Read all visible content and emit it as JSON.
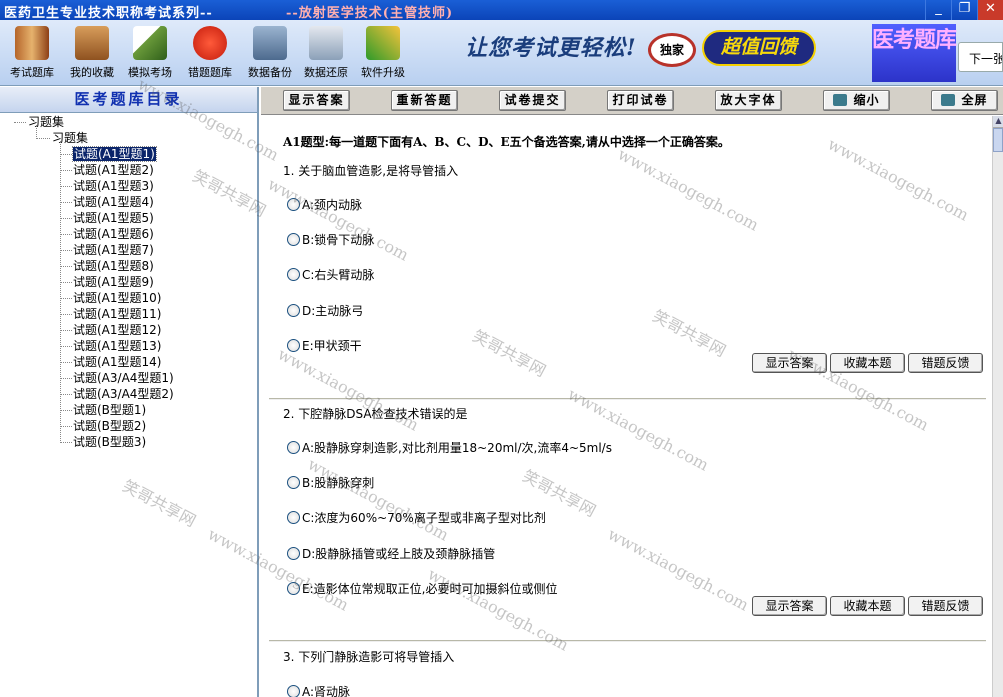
{
  "window": {
    "title_main": "医药卫生专业技术职称考试系列--",
    "title_sub": "--放射医学技术(主管技师)",
    "min": "_",
    "restore": "❐",
    "close": "✕"
  },
  "toolbar": {
    "items": [
      {
        "label": "考试题库",
        "icon": "book-icon"
      },
      {
        "label": "我的收藏",
        "icon": "box-icon"
      },
      {
        "label": "模拟考场",
        "icon": "pencil-paper-icon"
      },
      {
        "label": "错题题库",
        "icon": "red-x-icon"
      },
      {
        "label": "数据备份",
        "icon": "backup-chart-icon"
      },
      {
        "label": "数据还原",
        "icon": "restore-clock-icon"
      },
      {
        "label": "软件升级",
        "icon": "upgrade-arrow-icon"
      }
    ],
    "ad_slogan": "让您考试更轻松!",
    "ad_exclusive": "独家",
    "ad_badge": "超值回馈",
    "logo_text": "医考题库",
    "next_page": "下一张"
  },
  "left_panel": {
    "header": "医考题库目录",
    "root": "习题集",
    "child": "习题集",
    "items": [
      "试题(A1型题1)",
      "试题(A1型题2)",
      "试题(A1型题3)",
      "试题(A1型题4)",
      "试题(A1型题5)",
      "试题(A1型题6)",
      "试题(A1型题7)",
      "试题(A1型题8)",
      "试题(A1型题9)",
      "试题(A1型题10)",
      "试题(A1型题11)",
      "试题(A1型题12)",
      "试题(A1型题13)",
      "试题(A1型题14)",
      "试题(A3/A4型题1)",
      "试题(A3/A4型题2)",
      "试题(B型题1)",
      "试题(B型题2)",
      "试题(B型题3)"
    ],
    "selected_index": 0
  },
  "action_bar": {
    "show_answer": "显示答案",
    "redo": "重新答题",
    "submit": "试卷提交",
    "print": "打印试卷",
    "enlarge_font": "放大字体",
    "shrink": "缩小",
    "fullscreen": "全屏"
  },
  "instructions": "A1题型:每一道题下面有A、B、C、D、E五个备选答案,请从中选择一个正确答案。",
  "question_buttons": {
    "show_answer": "显示答案",
    "favorite": "收藏本题",
    "feedback": "错题反馈"
  },
  "questions": [
    {
      "text": "1. 关于脑血管造影,是将导管插入",
      "options": [
        "A:颈内动脉",
        "B:锁骨下动脉",
        "C:右头臂动脉",
        "D:主动脉弓",
        "E:甲状颈干"
      ]
    },
    {
      "text": "2. 下腔静脉DSA检查技术错误的是",
      "options": [
        "A:股静脉穿刺造影,对比剂用量18~20ml/次,流率4~5ml/s",
        "B:股静脉穿刺",
        "C:浓度为60%~70%离子型或非离子型对比剂",
        "D:股静脉插管或经上肢及颈静脉插管",
        "E:造影体位常规取正位,必要时可加摄斜位或侧位"
      ]
    },
    {
      "text": "3. 下列门静脉造影可将导管插入",
      "options": [
        "A:肾动脉"
      ]
    }
  ],
  "watermark": {
    "text_cn": "笑哥共享网",
    "text_url": "www.xiaogegh.com"
  }
}
